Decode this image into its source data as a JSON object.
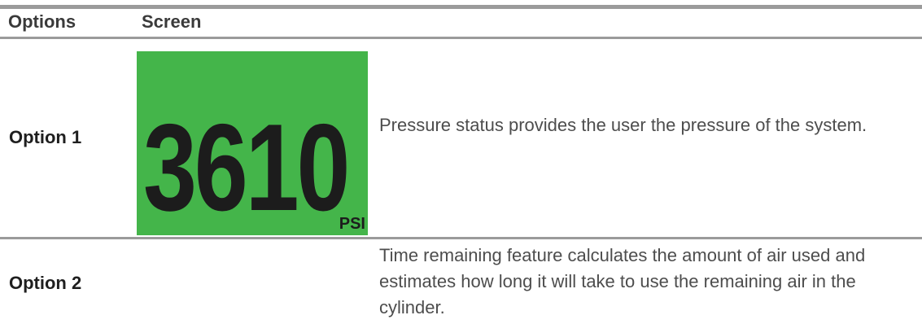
{
  "table": {
    "headers": {
      "options": "Options",
      "screen": "Screen"
    },
    "rows": [
      {
        "option": "Option 1",
        "screen": {
          "reading": "3610",
          "unit": "PSI",
          "background_color": "#44b54a"
        },
        "description": "Pressure status provides the user the pressure of the system."
      },
      {
        "option": "Option 2",
        "description": "Time remaining feature calculates the amount of air used and estimates how long it will take to use the remaining air in the cylinder."
      }
    ]
  }
}
